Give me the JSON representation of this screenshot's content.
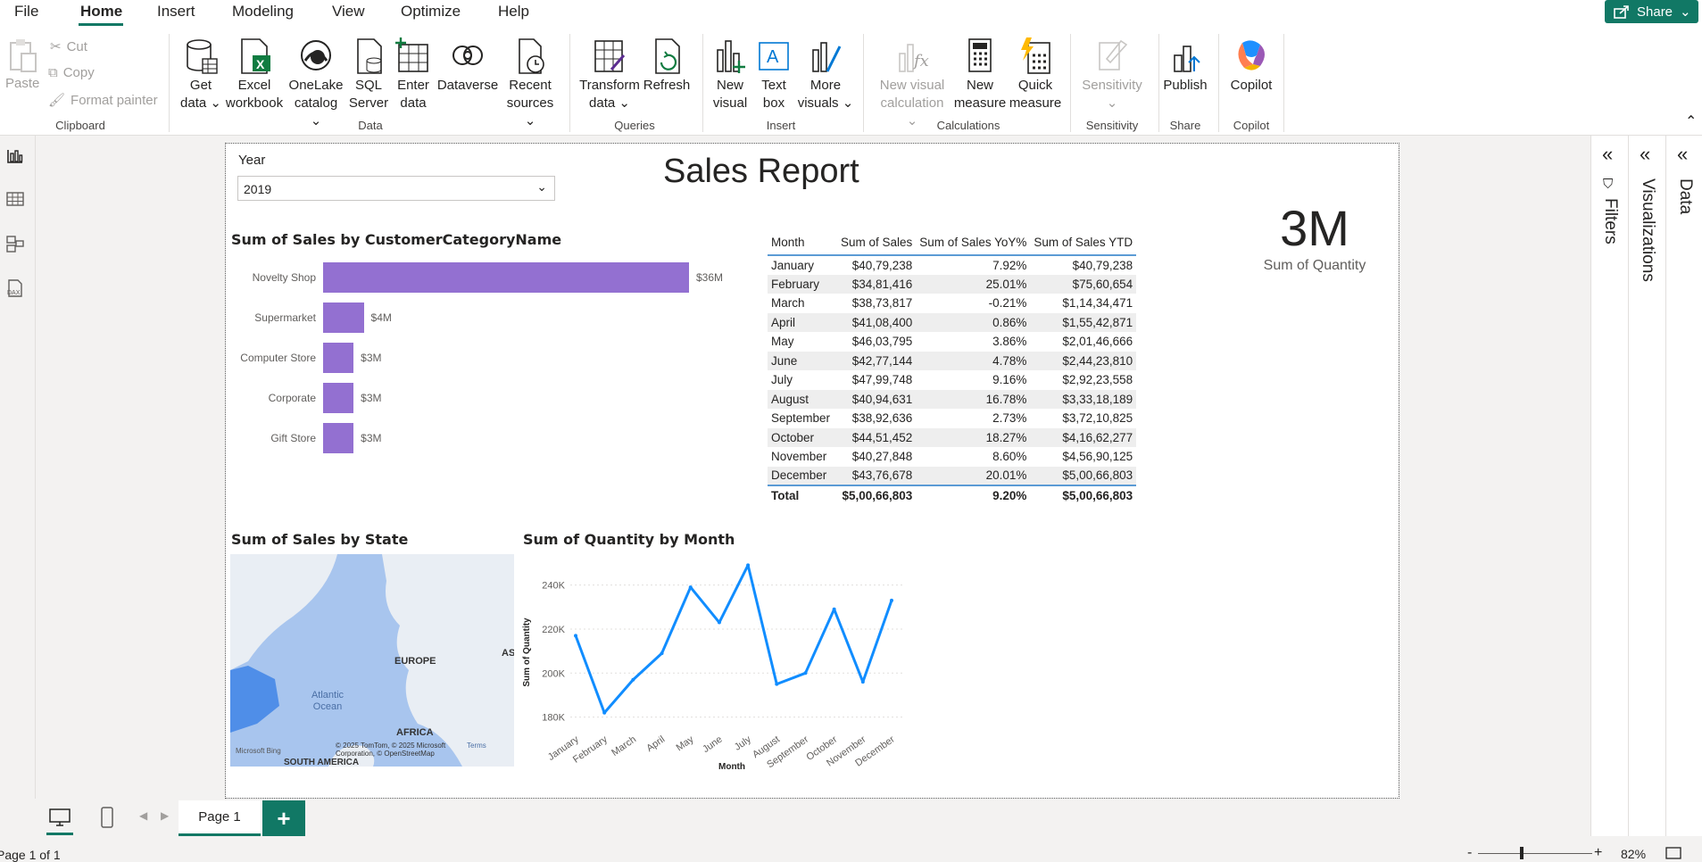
{
  "menu": {
    "items": [
      "File",
      "Home",
      "Insert",
      "Modeling",
      "View",
      "Optimize",
      "Help"
    ],
    "share": "Share"
  },
  "ribbon": {
    "clipboard": {
      "paste": "Paste",
      "cut": "Cut",
      "copy": "Copy",
      "format_painter": "Format painter",
      "label": "Clipboard"
    },
    "data": {
      "get_data": [
        "Get",
        "data"
      ],
      "excel": [
        "Excel",
        "workbook"
      ],
      "onelake": [
        "OneLake",
        "catalog"
      ],
      "sql": [
        "SQL",
        "Server"
      ],
      "enter": [
        "Enter",
        "data"
      ],
      "dataverse": [
        "Dataverse",
        ""
      ],
      "recent": [
        "Recent",
        "sources"
      ],
      "label": "Data"
    },
    "queries": {
      "transform": [
        "Transform",
        "data"
      ],
      "refresh": [
        "Refresh",
        ""
      ],
      "label": "Queries"
    },
    "insert": {
      "new_visual": [
        "New",
        "visual"
      ],
      "text_box": [
        "Text",
        "box"
      ],
      "more_visuals": [
        "More",
        "visuals"
      ],
      "label": "Insert"
    },
    "calculations": {
      "new_visual_calc": [
        "New visual",
        "calculation"
      ],
      "new_measure": [
        "New",
        "measure"
      ],
      "quick_measure": [
        "Quick",
        "measure"
      ],
      "label": "Calculations"
    },
    "sensitivity": {
      "btn": "Sensitivity",
      "label": "Sensitivity"
    },
    "share": {
      "publish": "Publish",
      "label": "Share"
    },
    "copilot": {
      "btn": "Copilot",
      "label": "Copilot"
    }
  },
  "panes": {
    "filters": "Filters",
    "visualizations": "Visualizations",
    "data": "Data"
  },
  "report": {
    "title": "Sales Report",
    "slicer": {
      "label": "Year",
      "value": "2019"
    },
    "bar_title": "Sum of Sales by CustomerCategoryName",
    "matrix_headers": [
      "Month",
      "Sum of Sales",
      "Sum of Sales YoY%",
      "Sum of Sales YTD"
    ],
    "matrix_rows": [
      [
        "January",
        "$40,79,238",
        "7.92%",
        "$40,79,238"
      ],
      [
        "February",
        "$34,81,416",
        "25.01%",
        "$75,60,654"
      ],
      [
        "March",
        "$38,73,817",
        "-0.21%",
        "$1,14,34,471"
      ],
      [
        "April",
        "$41,08,400",
        "0.86%",
        "$1,55,42,871"
      ],
      [
        "May",
        "$46,03,795",
        "3.86%",
        "$2,01,46,666"
      ],
      [
        "June",
        "$42,77,144",
        "4.78%",
        "$2,44,23,810"
      ],
      [
        "July",
        "$47,99,748",
        "9.16%",
        "$2,92,23,558"
      ],
      [
        "August",
        "$40,94,631",
        "16.78%",
        "$3,33,18,189"
      ],
      [
        "September",
        "$38,92,636",
        "2.73%",
        "$3,72,10,825"
      ],
      [
        "October",
        "$44,51,452",
        "18.27%",
        "$4,16,62,277"
      ],
      [
        "November",
        "$40,27,848",
        "8.60%",
        "$4,56,90,125"
      ],
      [
        "December",
        "$43,76,678",
        "20.01%",
        "$5,00,66,803"
      ]
    ],
    "matrix_total": [
      "Total",
      "$5,00,66,803",
      "9.20%",
      "$5,00,66,803"
    ],
    "card": {
      "value": "3M",
      "label": "Sum of Quantity"
    },
    "map_title": "Sum of Sales by State",
    "map_labels": {
      "europe": "EUROPE",
      "ocean": "Atlantic Ocean",
      "africa": "AFRICA",
      "south_america": "SOUTH AMERICA",
      "asia": "AS",
      "credit": "© 2025 TomTom, © 2025 Microsoft Corporation, © OpenStreetMap",
      "terms": "Terms",
      "bing": "Microsoft Bing"
    },
    "line_title": "Sum of Quantity by Month"
  },
  "chart_data": [
    {
      "type": "bar",
      "title": "Sum of Sales by CustomerCategoryName",
      "categories": [
        "Novelty Shop",
        "Supermarket",
        "Computer Store",
        "Corporate",
        "Gift Store"
      ],
      "values": [
        36,
        4,
        3,
        3,
        3
      ],
      "labels": [
        "$36M",
        "$4M",
        "$3M",
        "$3M",
        "$3M"
      ],
      "color": "#9370d1"
    },
    {
      "type": "line",
      "title": "Sum of Quantity by Month",
      "xlabel": "Month",
      "ylabel": "Sum of Quantity",
      "categories": [
        "January",
        "February",
        "March",
        "April",
        "May",
        "June",
        "July",
        "August",
        "September",
        "October",
        "November",
        "December"
      ],
      "values": [
        217000,
        182000,
        197000,
        209000,
        239000,
        223000,
        249000,
        195000,
        200000,
        229000,
        196000,
        233000
      ],
      "yticks": [
        180000,
        200000,
        220000,
        240000
      ],
      "ytick_labels": [
        "180K",
        "200K",
        "220K",
        "240K"
      ],
      "ylim": [
        175000,
        252000
      ],
      "color": "#118dff"
    }
  ],
  "bottom": {
    "page_tab": "Page 1",
    "add": "+"
  },
  "status": {
    "page_info": "Page 1 of 1",
    "zoom": "82%",
    "minus": "-",
    "plus": "+"
  }
}
